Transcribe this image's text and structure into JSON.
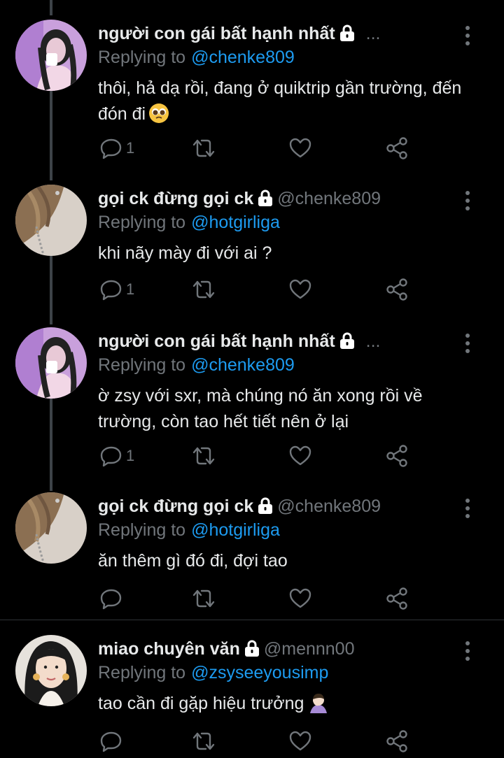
{
  "tweets": [
    {
      "name": "người con gái bất hạnh nhất",
      "handle": "",
      "header_overflow": "...",
      "replying_label": "Replying to",
      "replying_to": "@chenke809",
      "text": "thôi, hả dạ rồi, đang ở quiktrip gần trường, đến đón đi",
      "emoji": "pleading-face",
      "reply_count": "1",
      "avatar": "girl-pink"
    },
    {
      "name": "gọi ck đừng gọi ck",
      "handle": "@chenke809",
      "header_overflow": "",
      "replying_label": "Replying to",
      "replying_to": "@hotgirliga",
      "text": "khi nãy mày đi với ai ?",
      "emoji": "",
      "reply_count": "1",
      "avatar": "hair-light"
    },
    {
      "name": "người con gái bất hạnh nhất",
      "handle": "",
      "header_overflow": "...",
      "replying_label": "Replying to",
      "replying_to": "@chenke809",
      "text": "ờ zsy với sxr, mà chúng nó ăn xong rồi về trường, còn tao hết tiết nên ở lại",
      "emoji": "",
      "reply_count": "1",
      "avatar": "girl-pink"
    },
    {
      "name": "gọi ck đừng gọi ck",
      "handle": "@chenke809",
      "header_overflow": "",
      "replying_label": "Replying to",
      "replying_to": "@hotgirliga",
      "text": "ăn thêm gì đó đi, đợi tao",
      "emoji": "",
      "reply_count": "",
      "avatar": "hair-light"
    },
    {
      "name": "miao chuyên văn",
      "handle": "@mennn00",
      "header_overflow": "",
      "replying_label": "Replying to",
      "replying_to": "@zsyseeyousimp",
      "text": "tao cần đi gặp hiệu trưởng",
      "emoji": "person-facepalming",
      "reply_count": "",
      "avatar": "girl-portrait"
    }
  ],
  "colors": {
    "background": "#000000",
    "text": "#e7e9ea",
    "secondary": "#71767b",
    "link": "#1d9bf0",
    "thread_line": "#3d4348"
  },
  "icons": [
    "lock-icon",
    "more-icon",
    "reply-icon",
    "retweet-icon",
    "like-icon",
    "share-icon"
  ]
}
